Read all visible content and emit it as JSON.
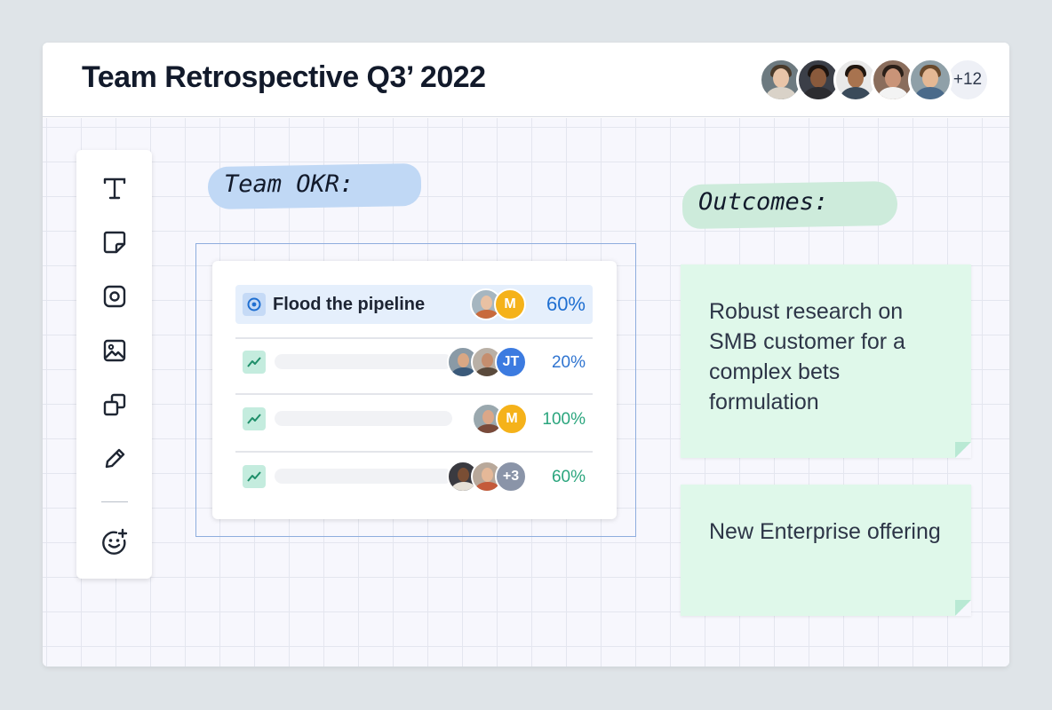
{
  "header": {
    "title": "Team Retrospective Q3’ 2022",
    "participants_more": "+12"
  },
  "toolbar": {
    "tools": [
      "text-tool",
      "sticky-note-tool",
      "shape-tool",
      "image-tool",
      "templates-tool",
      "pen-tool",
      "emoji-reaction-tool"
    ]
  },
  "labels": {
    "okr": "Team OKR:",
    "outcomes": "Outcomes:"
  },
  "okr_card": {
    "objective": {
      "title": "Flood the pipeline",
      "owner_initial": "M",
      "progress": "60%"
    },
    "key_results": [
      {
        "owners_initials": "JT",
        "progress": "20%"
      },
      {
        "owners_initials": "M",
        "progress": "100%"
      },
      {
        "owners_more": "+3",
        "progress": "60%"
      }
    ]
  },
  "notes": [
    {
      "text": "Robust research on SMB customer for a complex bets formulation"
    },
    {
      "text": "New Enterprise offering"
    }
  ],
  "colors": {
    "okr_label_bg": "#c0d8f5",
    "outcomes_label_bg": "#cdebdb",
    "note_bg": "#dff8ea",
    "accent_blue": "#1f6fd1",
    "accent_green": "#2aa57d"
  }
}
